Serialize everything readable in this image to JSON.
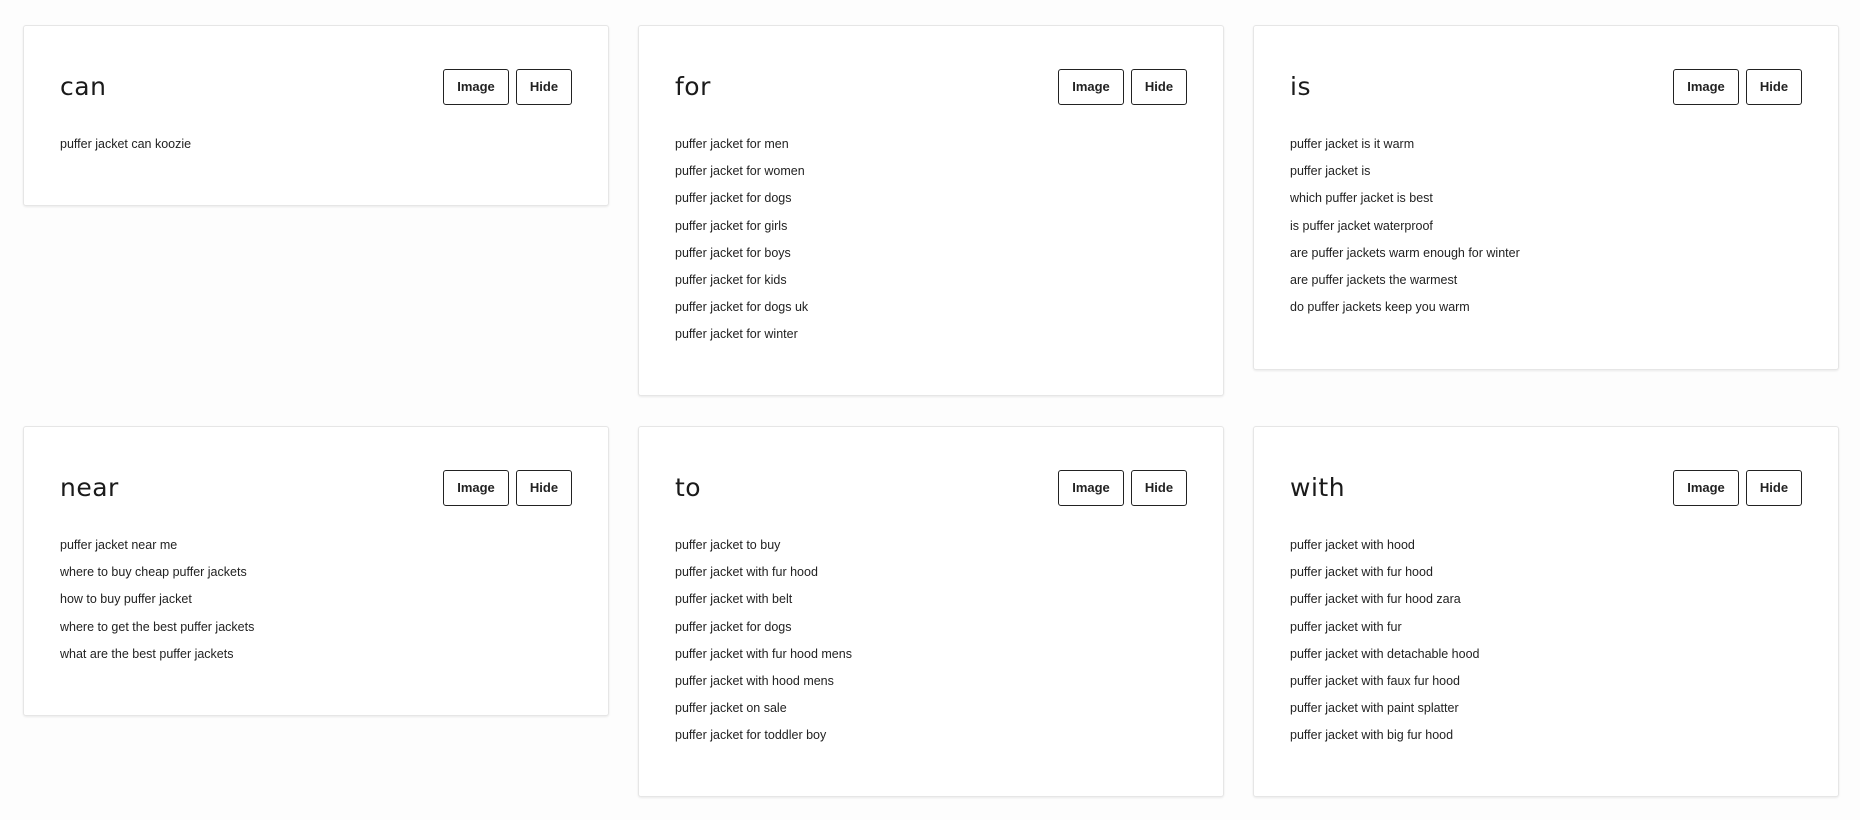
{
  "buttons": {
    "image_label": "Image",
    "hide_label": "Hide"
  },
  "cards": [
    {
      "title": "can",
      "items": [
        "puffer jacket can koozie"
      ]
    },
    {
      "title": "for",
      "items": [
        "puffer jacket for men",
        "puffer jacket for women",
        "puffer jacket for dogs",
        "puffer jacket for girls",
        "puffer jacket for boys",
        "puffer jacket for kids",
        "puffer jacket for dogs uk",
        "puffer jacket for winter"
      ]
    },
    {
      "title": "is",
      "items": [
        "puffer jacket is it warm",
        "puffer jacket is",
        "which puffer jacket is best",
        "is puffer jacket waterproof",
        "are puffer jackets warm enough for winter",
        "are puffer jackets the warmest",
        "do puffer jackets keep you warm"
      ]
    },
    {
      "title": "near",
      "items": [
        "puffer jacket near me",
        "where to buy cheap puffer jackets",
        "how to buy puffer jacket",
        "where to get the best puffer jackets",
        "what are the best puffer jackets"
      ]
    },
    {
      "title": "to",
      "items": [
        "puffer jacket to buy",
        "puffer jacket with fur hood",
        "puffer jacket with belt",
        "puffer jacket for dogs",
        "puffer jacket with fur hood mens",
        "puffer jacket with hood mens",
        "puffer jacket on sale",
        "puffer jacket for toddler boy"
      ]
    },
    {
      "title": "with",
      "items": [
        "puffer jacket with hood",
        "puffer jacket with fur hood",
        "puffer jacket with fur hood zara",
        "puffer jacket with fur",
        "puffer jacket with detachable hood",
        "puffer jacket with faux fur hood",
        "puffer jacket with paint splatter",
        "puffer jacket with big fur hood"
      ]
    }
  ]
}
